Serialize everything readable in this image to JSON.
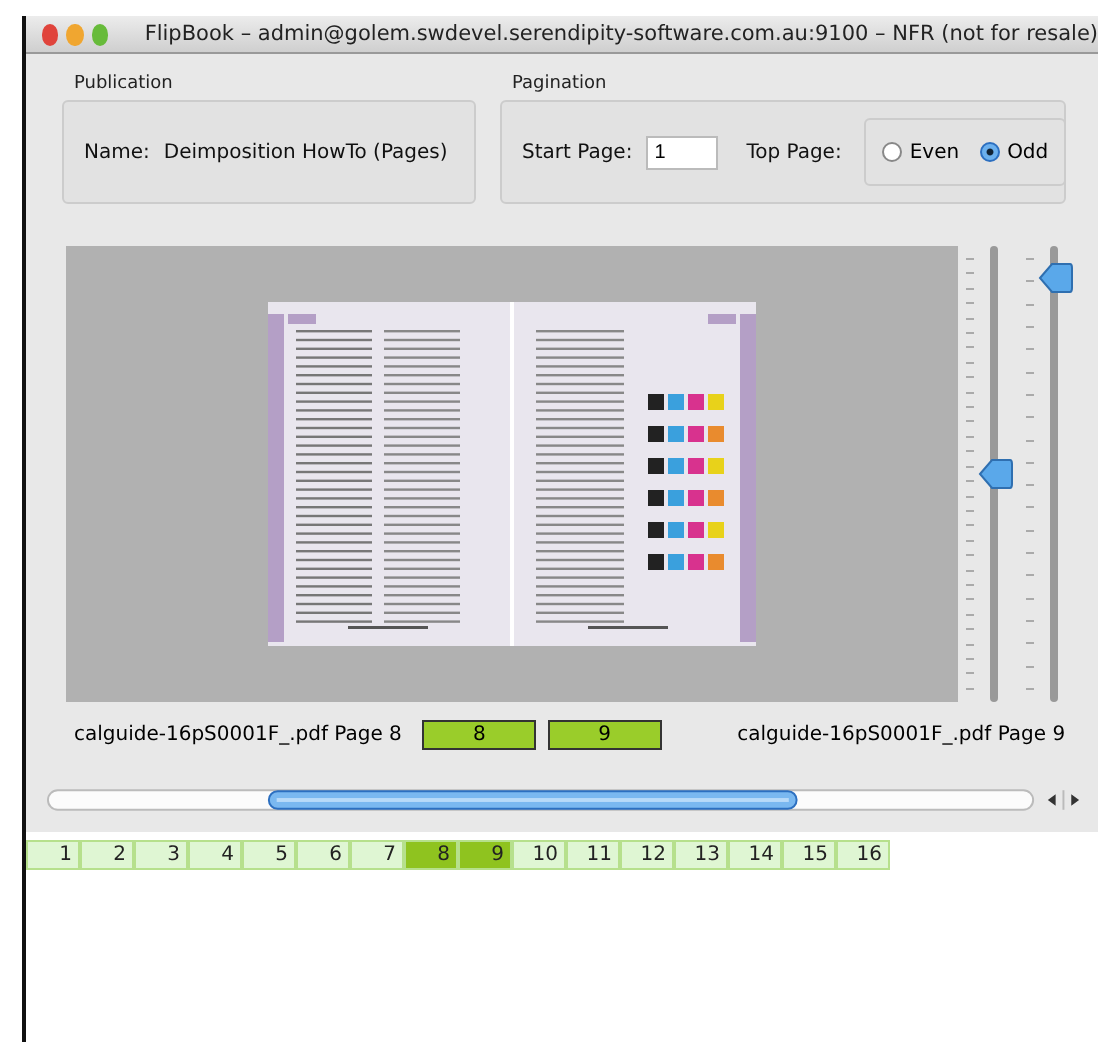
{
  "window": {
    "title": "FlipBook – admin@golem.swdevel.serendipity-software.com.au:9100 – NFR (not for resale)"
  },
  "publication": {
    "title": "Publication",
    "name_label": "Name:",
    "name": "Deimposition HowTo (Pages)"
  },
  "pagination": {
    "title": "Pagination",
    "start_label": "Start Page:",
    "start_value": "1",
    "top_label": "Top Page:",
    "options": [
      {
        "label": "Even",
        "selected": false
      },
      {
        "label": "Odd",
        "selected": true
      }
    ]
  },
  "sliders": [
    {
      "level": 0.5
    },
    {
      "level": 0.93
    }
  ],
  "spread": {
    "left_label": "calguide-16pS0001F_.pdf Page 8",
    "right_label": "calguide-16pS0001F_.pdf Page 9",
    "left_page": "8",
    "right_page": "9"
  },
  "pages": [
    {
      "label": "1",
      "selected": false
    },
    {
      "label": "2",
      "selected": false
    },
    {
      "label": "3",
      "selected": false
    },
    {
      "label": "4",
      "selected": false
    },
    {
      "label": "5",
      "selected": false
    },
    {
      "label": "6",
      "selected": false
    },
    {
      "label": "7",
      "selected": false
    },
    {
      "label": "8",
      "selected": true
    },
    {
      "label": "9",
      "selected": true
    },
    {
      "label": "10",
      "selected": false
    },
    {
      "label": "11",
      "selected": false
    },
    {
      "label": "12",
      "selected": false
    },
    {
      "label": "13",
      "selected": false
    },
    {
      "label": "14",
      "selected": false
    },
    {
      "label": "15",
      "selected": false
    },
    {
      "label": "16",
      "selected": false
    }
  ]
}
